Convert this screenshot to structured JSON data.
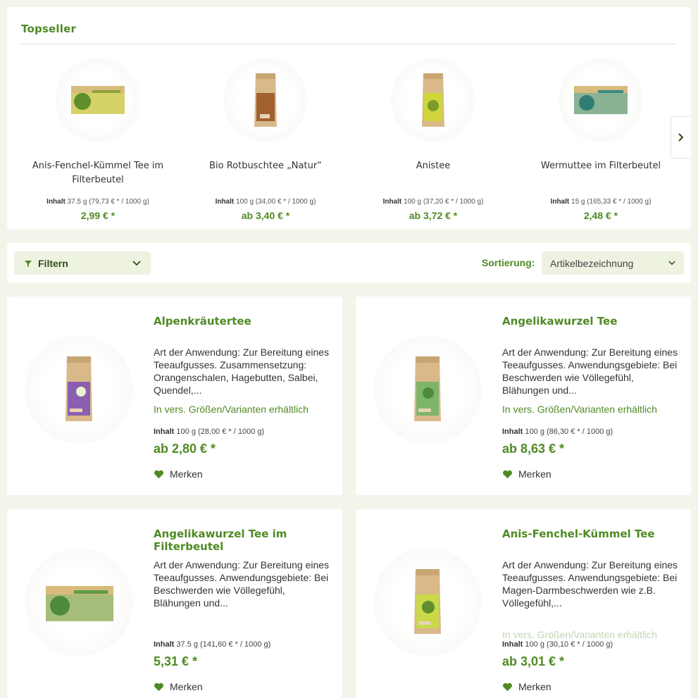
{
  "topseller": {
    "title": "Topseller",
    "items": [
      {
        "name": "Anis-Fenchel-Kümmel Tee im Filterbeutel",
        "content_label": "Inhalt",
        "content_value": "37.5 g (79,73 € * / 1000 g)",
        "price": "2,99 € *",
        "package": "box",
        "color": "#c9d94a"
      },
      {
        "name": "Bio Rotbuschtee „Natur“",
        "content_label": "Inhalt",
        "content_value": "100 g (34,00 € * / 1000 g)",
        "price": "ab 3,40 € *",
        "package": "bag",
        "color": "#a0612f"
      },
      {
        "name": "Anistee",
        "content_label": "Inhalt",
        "content_value": "100 g (37,20 € * / 1000 g)",
        "price": "ab 3,72 € *",
        "package": "bag",
        "color": "#cfd63a"
      },
      {
        "name": "Wermuttee im Filterbeutel",
        "content_label": "Inhalt",
        "content_value": "15 g (165,33 € * / 1000 g)",
        "price": "2,48 € *",
        "package": "box",
        "color": "#4ea39a"
      }
    ]
  },
  "filter": {
    "label": "Filtern",
    "sort_label": "Sortierung:",
    "sort_value": "Artikelbezeichnung"
  },
  "products": [
    {
      "title": "Alpenkräutertee",
      "description": "Art der Anwendung: Zur Bereitung eines Teeaufgusses. Zusammensetzung: Orangenschalen, Hagebutten, Salbei, Quendel,...",
      "variants": "In vers. Größen/Varianten erhältlich",
      "content_label": "Inhalt",
      "content_value": "100 g (28,00 € * / 1000 g)",
      "price": "ab 2,80 € *",
      "merken": "Merken",
      "package": "bag",
      "color": "#8b5fb0"
    },
    {
      "title": "Angelikawurzel Tee",
      "description": "Art der Anwendung: Zur Bereitung eines Teeaufgusses. Anwendungsgebiete: Bei Beschwerden wie Völlegefühl, Blähungen und...",
      "variants": "In vers. Größen/Varianten erhältlich",
      "content_label": "Inhalt",
      "content_value": "100 g (86,30 € * / 1000 g)",
      "price": "ab 8,63 € *",
      "merken": "Merken",
      "package": "bag",
      "color": "#7cb56a"
    },
    {
      "title": "Angelikawurzel Tee im Filterbeutel",
      "description": "Art der Anwendung: Zur Bereitung eines Teeaufgusses. Anwendungsgebiete: Bei Beschwerden wie Völlegefühl, Blähungen und...",
      "variants": "",
      "content_label": "Inhalt",
      "content_value": "37.5 g (141,60 € * / 1000 g)",
      "price": "5,31 € *",
      "merken": "Merken",
      "package": "box",
      "color": "#7cb56a"
    },
    {
      "title": "Anis-Fenchel-Kümmel Tee",
      "description": "Art der Anwendung: Zur Bereitung eines Teeaufgusses. Anwendungsgebiete: Bei Magen-Darmbeschwerden wie z.B. Völlegefühl,...",
      "variants": "In vers. Größen/Varianten erhältlich",
      "content_label": "Inhalt",
      "content_value": "100 g (30,10 € * / 1000 g)",
      "price": "ab 3,01 € *",
      "merken": "Merken",
      "package": "bag",
      "color": "#c9d94a"
    }
  ]
}
